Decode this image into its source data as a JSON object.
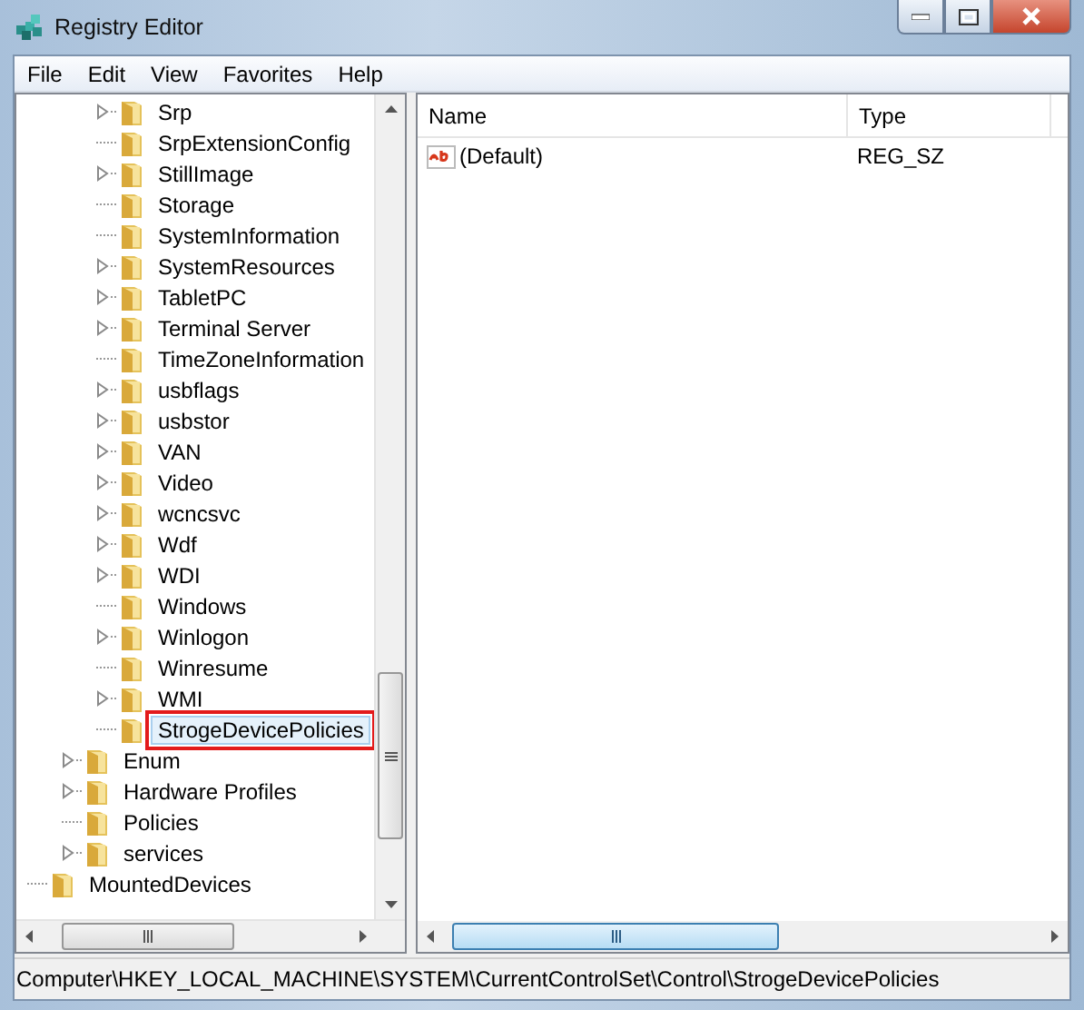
{
  "window": {
    "title": "Registry Editor"
  },
  "menu": [
    "File",
    "Edit",
    "View",
    "Favorites",
    "Help"
  ],
  "tree": {
    "items": [
      {
        "children": [
          {
            "children": [
              {
                "label": "Srp",
                "expandable": true,
                "selected": false,
                "outlined": false
              },
              {
                "label": "SrpExtensionConfig",
                "expandable": false,
                "selected": false,
                "outlined": false
              },
              {
                "label": "StillImage",
                "expandable": true,
                "selected": false,
                "outlined": false
              },
              {
                "label": "Storage",
                "expandable": false,
                "selected": false,
                "outlined": false
              },
              {
                "label": "SystemInformation",
                "expandable": false,
                "selected": false,
                "outlined": false
              },
              {
                "label": "SystemResources",
                "expandable": true,
                "selected": false,
                "outlined": false
              },
              {
                "label": "TabletPC",
                "expandable": true,
                "selected": false,
                "outlined": false
              },
              {
                "label": "Terminal Server",
                "expandable": true,
                "selected": false,
                "outlined": false
              },
              {
                "label": "TimeZoneInformation",
                "expandable": false,
                "selected": false,
                "outlined": false
              },
              {
                "label": "usbflags",
                "expandable": true,
                "selected": false,
                "outlined": false
              },
              {
                "label": "usbstor",
                "expandable": true,
                "selected": false,
                "outlined": false
              },
              {
                "label": "VAN",
                "expandable": true,
                "selected": false,
                "outlined": false
              },
              {
                "label": "Video",
                "expandable": true,
                "selected": false,
                "outlined": false
              },
              {
                "label": "wcncsvc",
                "expandable": true,
                "selected": false,
                "outlined": false
              },
              {
                "label": "Wdf",
                "expandable": true,
                "selected": false,
                "outlined": false
              },
              {
                "label": "WDI",
                "expandable": true,
                "selected": false,
                "outlined": false
              },
              {
                "label": "Windows",
                "expandable": false,
                "selected": false,
                "outlined": false
              },
              {
                "label": "Winlogon",
                "expandable": true,
                "selected": false,
                "outlined": false
              },
              {
                "label": "Winresume",
                "expandable": false,
                "selected": false,
                "outlined": false
              },
              {
                "label": "WMI",
                "expandable": true,
                "selected": false,
                "outlined": false
              },
              {
                "label": "StrogeDevicePolicies",
                "expandable": false,
                "selected": true,
                "outlined": true
              }
            ]
          },
          {
            "label": "Enum",
            "expandable": true,
            "selected": false,
            "outlined": false
          },
          {
            "label": "Hardware Profiles",
            "expandable": true,
            "selected": false,
            "outlined": false
          },
          {
            "label": "Policies",
            "expandable": false,
            "selected": false,
            "outlined": false
          },
          {
            "label": "services",
            "expandable": true,
            "selected": false,
            "outlined": false
          }
        ]
      },
      {
        "label": "MountedDevices",
        "expandable": false,
        "selected": false,
        "outlined": false
      }
    ]
  },
  "values": {
    "columns": [
      "Name",
      "Type"
    ],
    "rows": [
      {
        "name": "(Default)",
        "type": "REG_SZ"
      }
    ]
  },
  "status_bar": "Computer\\HKEY_LOCAL_MACHINE\\SYSTEM\\CurrentControlSet\\Control\\StrogeDevicePolicies"
}
